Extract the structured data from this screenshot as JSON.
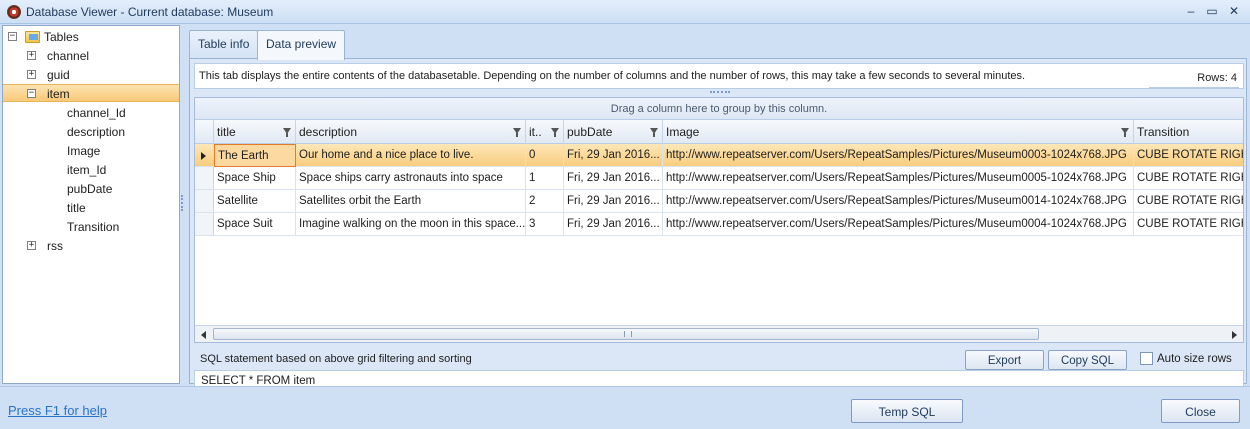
{
  "window": {
    "title": "Database Viewer - Current database: Museum",
    "minimize_label": "‒",
    "maximize_label": "▭",
    "close_label": "✕"
  },
  "tree": {
    "root_label": "Tables",
    "nodes": [
      {
        "label": "channel",
        "expander": "+"
      },
      {
        "label": "guid",
        "expander": "+"
      },
      {
        "label": "item",
        "expander": "−"
      }
    ],
    "item_children": [
      "channel_Id",
      "description",
      "Image",
      "item_Id",
      "pubDate",
      "title",
      "Transition"
    ],
    "last_node": {
      "label": "rss",
      "expander": "+"
    }
  },
  "tabs": [
    {
      "label": "Table info"
    },
    {
      "label": "Data preview"
    }
  ],
  "info_text": "This tab displays the entire contents of the databasetable. Depending on the number of columns and the number of rows, this may take a few seconds to several minutes.",
  "rows_label": "Rows: 4",
  "grid": {
    "group_hint": "Drag a column here to group by this column.",
    "columns": [
      "title",
      "description",
      "it..",
      "pubDate",
      "Image",
      "Transition"
    ],
    "rows": [
      [
        "The Earth",
        "Our home and a nice place to live.",
        "0",
        "Fri, 29 Jan 2016...",
        "http://www.repeatserver.com/Users/RepeatSamples/Pictures/Museum0003-1024x768.JPG",
        "CUBE ROTATE RIGHT"
      ],
      [
        "Space Ship",
        "Space ships carry astronauts into space",
        "1",
        "Fri, 29 Jan 2016...",
        "http://www.repeatserver.com/Users/RepeatSamples/Pictures/Museum0005-1024x768.JPG",
        "CUBE ROTATE RIGHT"
      ],
      [
        "Satellite",
        "Satellites orbit the Earth",
        "2",
        "Fri, 29 Jan 2016...",
        "http://www.repeatserver.com/Users/RepeatSamples/Pictures/Museum0014-1024x768.JPG",
        "CUBE ROTATE RIGHT"
      ],
      [
        "Space Suit",
        "Imagine walking on the moon in this space...",
        "3",
        "Fri, 29 Jan 2016...",
        "http://www.repeatserver.com/Users/RepeatSamples/Pictures/Museum0004-1024x768.JPG",
        "CUBE ROTATE RIGHT"
      ]
    ]
  },
  "sql": {
    "label": "SQL statement based on above grid filtering and sorting",
    "export_label": "Export",
    "copy_label": "Copy SQL",
    "auto_size_label": "Auto size rows",
    "statement": "SELECT * FROM item"
  },
  "footer": {
    "help_link": "Press F1 for help",
    "temp_sql_label": "Temp SQL",
    "close_label": "Close"
  },
  "colors": {
    "selection": "#f9cd7e",
    "accent": "#2b72c9"
  }
}
